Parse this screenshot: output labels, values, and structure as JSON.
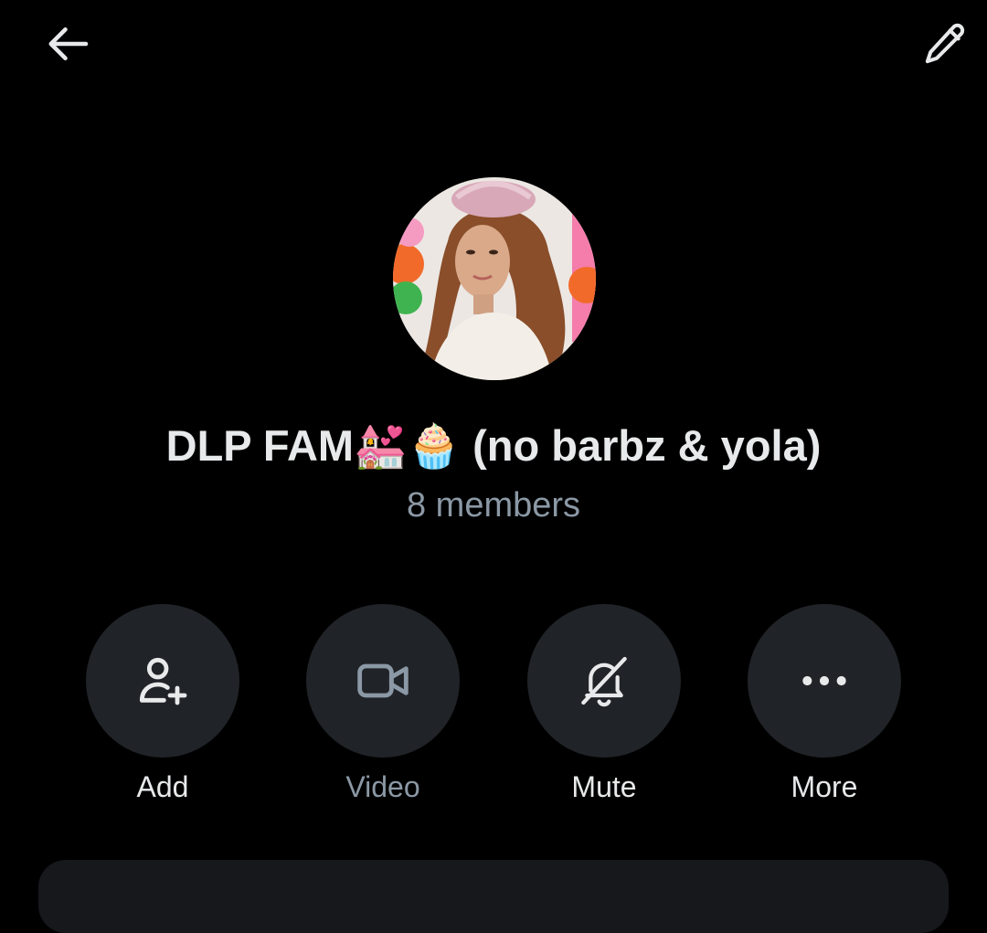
{
  "header": {
    "back_icon": "arrow-left-icon",
    "edit_icon": "pencil-icon"
  },
  "group": {
    "name": "DLP FAM💒🧁 (no barbz & yola)",
    "member_count": "8 members",
    "avatar": "group-avatar-photo"
  },
  "actions": [
    {
      "label": "Add",
      "icon": "add-person-icon",
      "enabled": true
    },
    {
      "label": "Video",
      "icon": "video-camera-icon",
      "enabled": false
    },
    {
      "label": "Mute",
      "icon": "bell-off-icon",
      "enabled": true
    },
    {
      "label": "More",
      "icon": "more-dots-icon",
      "enabled": true
    }
  ],
  "colors": {
    "background": "#000000",
    "primary_text": "#e7e9ea",
    "secondary_text": "#8b98a5",
    "button_fill": "#202327"
  }
}
